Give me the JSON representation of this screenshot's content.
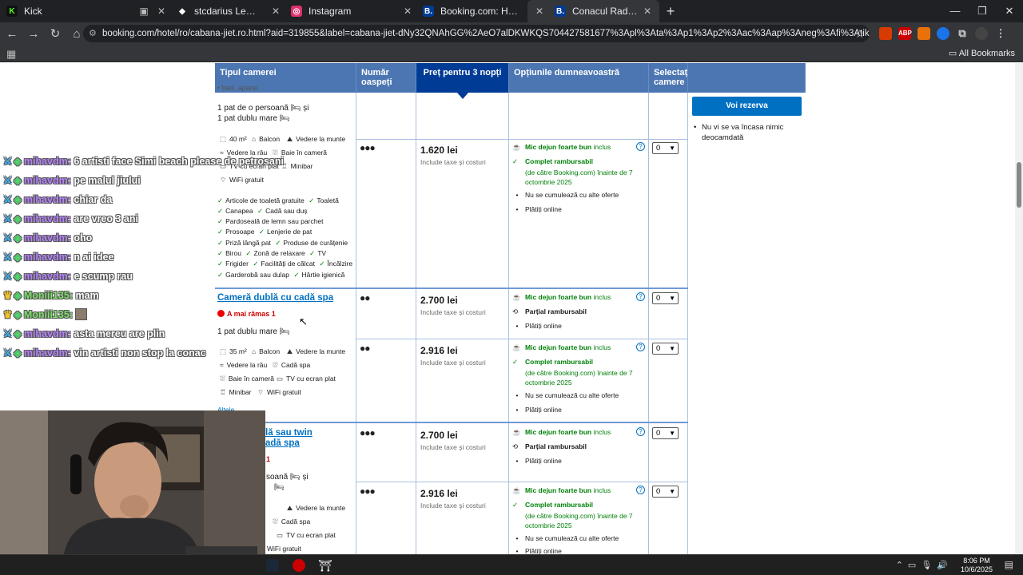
{
  "browser": {
    "tabs": [
      {
        "title": "Kick",
        "fav_color": "#53fc18",
        "fav_glyph": "K"
      },
      {
        "title": "stcdarius LeaderBoard | The be",
        "fav_color": "#ffffff",
        "fav_glyph": "◆"
      },
      {
        "title": "Instagram",
        "fav_color": "#e1306c",
        "fav_glyph": "◎"
      },
      {
        "title": "Booking.com: Hoteluri în Petroș",
        "fav_color": "#003b95",
        "fav_glyph": "B."
      },
      {
        "title": "Conacul Radacinilor, Petroșani",
        "fav_color": "#003b95",
        "fav_glyph": "B."
      }
    ],
    "new_tab": "+",
    "window_controls": [
      "—",
      "❐",
      "✕"
    ],
    "url": "booking.com/hotel/ro/cabana-jiet.ro.html?aid=319855&label=cabana-jiet-dNy32QNAhGG%2AeO7alDKWKQS704427581677%3Apl%3Ata%3Ap1%3Ap2%3Aac%3Aap%3Aneg%3Afi%3Atikwd-2161014033816%3Alp1011818%3...",
    "all_bookmarks": "All Bookmarks"
  },
  "table": {
    "headers": {
      "room_type": "Tipul camerei",
      "guests": "Număr oaspeți",
      "price": "Preț pentru 3 nopți",
      "options": "Opțiunile dumneavoastră",
      "select": "Selectați camere"
    },
    "room1": {
      "cut_text": "• bed, aparel",
      "bed1": "1 pat de o persoană",
      "and": "și",
      "bed2": "1 pat dublu mare",
      "facilities": [
        "40 m²",
        "Balcon",
        "Vedere la munte",
        "Vedere la râu",
        "Baie în cameră",
        "TV cu ecran plat",
        "Minibar",
        "WiFi gratuit"
      ],
      "amenities": [
        [
          "Articole de toaletă gratuite",
          "Toaletă"
        ],
        [
          "Canapea",
          "Cadă sau duș"
        ],
        [
          "Pardoseală de lemn sau parchet"
        ],
        [
          "Prosoape",
          "Lenjerie de pat"
        ],
        [
          "Priză lângă pat",
          "Produse de curățenie"
        ],
        [
          "Birou",
          "Zonă de relaxare",
          "TV"
        ],
        [
          "Frigider",
          "Facilități de călcat",
          "Încălzire"
        ],
        [
          "Garderobă sau dulap",
          "Hârtie igienică"
        ]
      ],
      "guests": "●●●",
      "price": "1.620 lei",
      "taxes": "Include taxe și costuri",
      "breakfast": "Mic dejun foarte bun",
      "breakfast_suffix": "inclus",
      "refund": "Complet rambursabil",
      "refund_detail": "(de către Booking.com) înainte de 7 octombrie 2025",
      "no_combine": "Nu se cumulează cu alte oferte",
      "pay_online": "Plătiți online",
      "select_value": "0"
    },
    "room2": {
      "name": "Cameră dublă cu cadă spa",
      "remaining": "A mai rămas 1",
      "bed": "1 pat dublu mare",
      "facilities": [
        "35 m²",
        "Balcon",
        "Vedere la munte",
        "Vedere la râu",
        "Cadă spa",
        "Baie în cameră",
        "TV cu ecran plat",
        "Minibar",
        "WiFi gratuit"
      ],
      "more": "Altele",
      "offer1": {
        "guests": "●●",
        "price": "2.700 lei",
        "taxes": "Include taxe și costuri",
        "breakfast": "Mic dejun foarte bun",
        "breakfast_suffix": "inclus",
        "refund": "Parțial rambursabil",
        "pay_online": "Plătiți online",
        "select_value": "0"
      },
      "offer2": {
        "guests": "●●",
        "price": "2.916 lei",
        "taxes": "Include taxe și costuri",
        "breakfast": "Mic dejun foarte bun",
        "breakfast_suffix": "inclus",
        "refund": "Complet rambursabil",
        "refund_detail": "(de către Booking.com) înainte de 7 octombrie 2025",
        "no_combine": "Nu se cumulează cu alte oferte",
        "pay_online": "Plătiți online",
        "select_value": "0"
      }
    },
    "room3": {
      "name_part1": "lă sau twin",
      "name_part2": "adă spa",
      "remaining": "1",
      "bed1": "soană",
      "and": "și",
      "facilities": [
        "Vedere la munte",
        "Cadă spa",
        "TV cu ecran plat",
        "WiFi gratuit"
      ],
      "offer1": {
        "guests": "●●●",
        "price": "2.700 lei",
        "taxes": "Include taxe și costuri",
        "breakfast": "Mic dejun foarte bun",
        "breakfast_suffix": "inclus",
        "refund": "Parțial rambursabil",
        "pay_online": "Plătiți online",
        "select_value": "0"
      },
      "offer2": {
        "guests": "●●●",
        "price": "2.916 lei",
        "taxes": "Include taxe și costuri",
        "breakfast": "Mic dejun foarte bun",
        "breakfast_suffix": "inclus",
        "refund": "Complet rambursabil",
        "refund_detail": "(de către Booking.com) înainte de 7 octombrie 2025",
        "no_combine": "Nu se cumulează cu alte oferte",
        "pay_online": "Plătiți online",
        "select_value": "0"
      }
    }
  },
  "reserve": {
    "button": "Voi rezerva",
    "note": "Nu vi se va încasa nimic deocamdată"
  },
  "chat": [
    {
      "user": "mihavdm",
      "msg": "6 artisti face Simi beach please de petrosani",
      "crown": false
    },
    {
      "user": "mihavdm",
      "msg": "pe malul jiului",
      "crown": false
    },
    {
      "user": "mihavdm",
      "msg": "chiar da",
      "crown": false
    },
    {
      "user": "mihavdm",
      "msg": "are vreo 3 ani",
      "crown": false
    },
    {
      "user": "mihavdm",
      "msg": "oho",
      "crown": false
    },
    {
      "user": "mihavdm",
      "msg": "n ai idee",
      "crown": false
    },
    {
      "user": "mihavdm",
      "msg": "e scump rau",
      "crown": false
    },
    {
      "user": "Moniii135",
      "msg": "mam",
      "crown": true
    },
    {
      "user": "Moniii135",
      "msg": "",
      "crown": true,
      "emote": true
    },
    {
      "user": "mihavdm",
      "msg": "asta mereu are plin",
      "crown": false
    },
    {
      "user": "mihavdm",
      "msg": "vin artisti non stop la conac",
      "crown": false
    }
  ],
  "taskbar": {
    "time": "8:06 PM",
    "date": "10/6/2025"
  },
  "colors": {
    "header_blue": "#4c76b2",
    "header_active": "#003b95",
    "link_blue": "#0071c2",
    "green": "#008009",
    "urgent_red": "#cc0000"
  }
}
